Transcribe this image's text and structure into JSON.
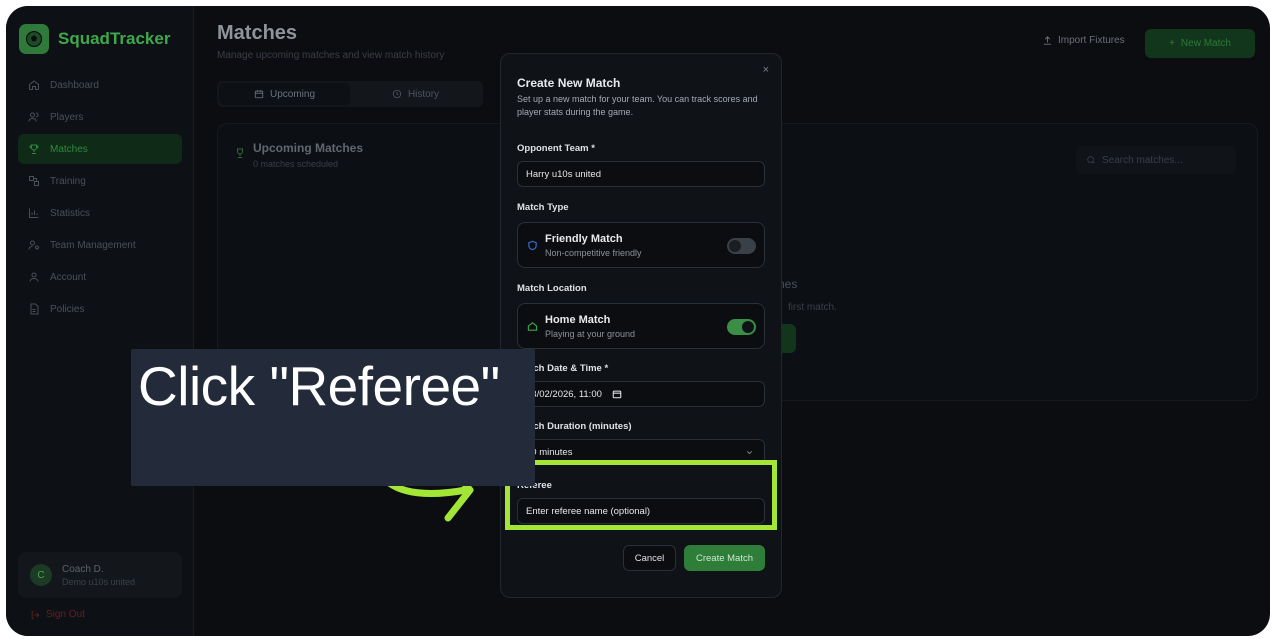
{
  "app": {
    "brand": "SquadTracker",
    "accent_color": "#3ea84c",
    "highlight_color": "#a3e635"
  },
  "sidebar": {
    "items": [
      {
        "label": "Dashboard",
        "icon": "home-icon"
      },
      {
        "label": "Players",
        "icon": "users-icon"
      },
      {
        "label": "Matches",
        "icon": "trophy-icon",
        "active": true
      },
      {
        "label": "Training",
        "icon": "training-icon"
      },
      {
        "label": "Statistics",
        "icon": "bar-chart-icon"
      },
      {
        "label": "Team Management",
        "icon": "team-settings-icon"
      },
      {
        "label": "Account",
        "icon": "user-icon"
      },
      {
        "label": "Policies",
        "icon": "document-icon"
      }
    ],
    "user": {
      "name": "Coach D.",
      "team": "Demo u10s united",
      "initial": "C"
    },
    "signout": "Sign Out"
  },
  "header": {
    "title": "Matches",
    "subtitle": "Manage upcoming matches and view match history",
    "import_label": "Import Fixtures",
    "new_match_label": "New Match"
  },
  "tabs": [
    {
      "label": "Upcoming",
      "icon": "calendar-icon",
      "active": true
    },
    {
      "label": "History",
      "icon": "history-icon"
    }
  ],
  "panel": {
    "title": "Upcoming Matches",
    "subtitle": "0 matches scheduled",
    "search_placeholder": "Search matches...",
    "empty_title_tail": "hes",
    "empty_sub_tail": "first match."
  },
  "dialog": {
    "title": "Create New Match",
    "description": "Set up a new match for your team. You can track scores and player stats during the game.",
    "close": "×",
    "opponent_label": "Opponent Team *",
    "opponent_value": "Harry u10s united",
    "match_type_label": "Match Type",
    "friendly": {
      "title": "Friendly Match",
      "subtitle": "Non-competitive friendly",
      "enabled": false
    },
    "location_label": "Match Location",
    "home": {
      "title": "Home Match",
      "subtitle": "Playing at your ground",
      "enabled": true
    },
    "datetime_label": "Match Date & Time *",
    "datetime_value": "13/02/2026, 11:00",
    "duration_label": "Match Duration (minutes)",
    "duration_value": "60 minutes",
    "referee_label": "Referee",
    "referee_placeholder": "Enter referee name (optional)",
    "cancel": "Cancel",
    "create": "Create Match"
  },
  "callout": {
    "text": "Click \"Referee\""
  }
}
